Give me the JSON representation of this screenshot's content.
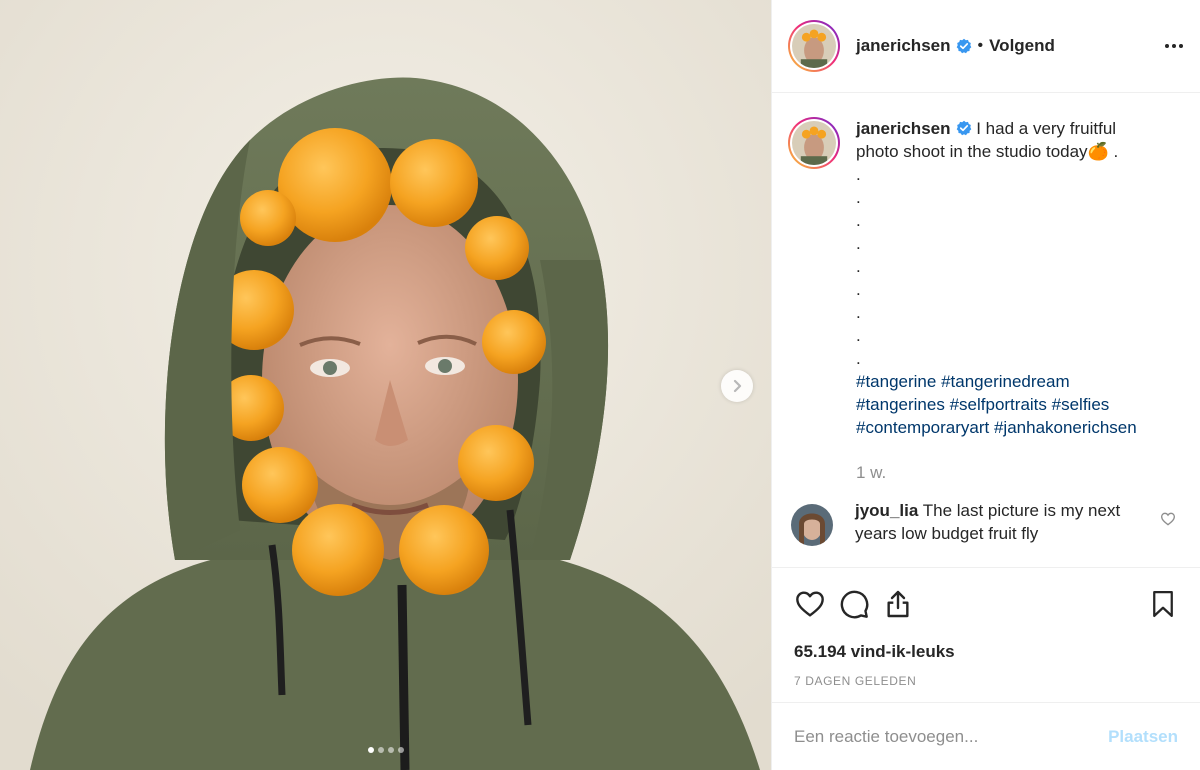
{
  "post": {
    "username": "janerichsen",
    "follow_separator": "•",
    "follow_label": "Volgend",
    "more_icon": "ellipsis-icon",
    "verified_color": "#3897f0"
  },
  "caption": {
    "username": "janerichsen",
    "text": "I had a very fruitful photo shoot in the studio today🍊 .",
    "dot_lines": [
      ".",
      ".",
      ".",
      ".",
      ".",
      ".",
      ".",
      ".",
      "."
    ],
    "hashtags": [
      "#tangerine",
      "#tangerinedream",
      "#tangerines",
      "#selfportraits",
      "#selfies",
      "#contemporaryart",
      "#janhakonerichsen"
    ],
    "age": "1 w."
  },
  "comment": {
    "username": "jyou_lia",
    "text": "The last picture is my next years low budget fruit fly"
  },
  "actions": {
    "like_icon": "heart-icon",
    "comment_icon": "speech-bubble-icon",
    "share_icon": "share-icon",
    "save_icon": "bookmark-icon"
  },
  "likes": "65.194 vind-ik-leuks",
  "timestamp": "7 DAGEN GELEDEN",
  "add_comment": {
    "placeholder": "Een reactie toevoegen...",
    "post_label": "Plaatsen"
  },
  "carousel": {
    "dots": 4,
    "active_index": 0
  }
}
